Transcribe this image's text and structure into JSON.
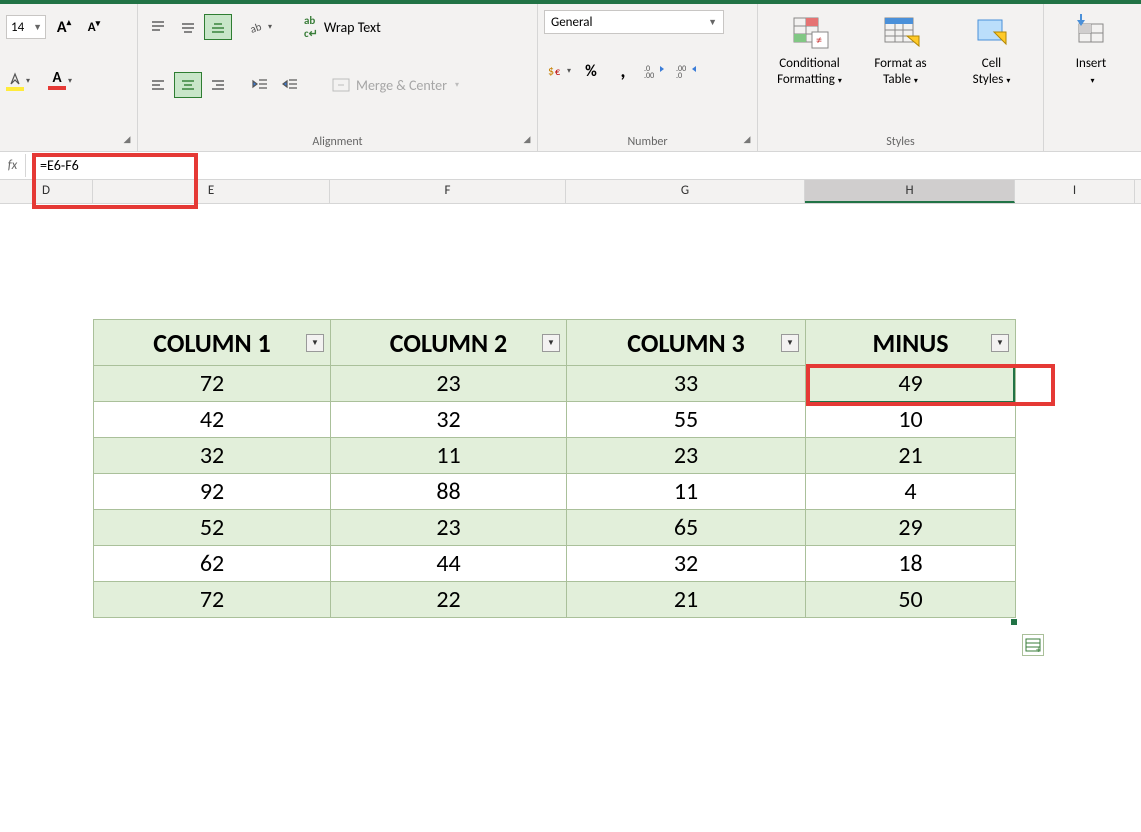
{
  "ribbon": {
    "font": {
      "size": "14",
      "increase_tip": "A",
      "decrease_tip": "A"
    },
    "alignment": {
      "label": "Alignment",
      "wrap": "Wrap Text",
      "merge": "Merge & Center"
    },
    "number": {
      "label": "Number",
      "format": "General"
    },
    "styles": {
      "label": "Styles",
      "conditional_line1": "Conditional",
      "conditional_line2": "Formatting",
      "formatas_line1": "Format as",
      "formatas_line2": "Table",
      "cellstyles_line1": "Cell",
      "cellstyles_line2": "Styles"
    },
    "cells": {
      "insert": "Insert"
    }
  },
  "formula": "=E6-F6",
  "columns": {
    "d": "D",
    "e": "E",
    "f": "F",
    "g": "G",
    "h": "H",
    "i": "I"
  },
  "table": {
    "headers": [
      "COLUMN 1",
      "COLUMN 2",
      "COLUMN 3",
      "MINUS"
    ],
    "rows": [
      [
        "72",
        "23",
        "33",
        "49"
      ],
      [
        "42",
        "32",
        "55",
        "10"
      ],
      [
        "32",
        "11",
        "23",
        "21"
      ],
      [
        "92",
        "88",
        "11",
        "4"
      ],
      [
        "52",
        "23",
        "65",
        "29"
      ],
      [
        "62",
        "44",
        "32",
        "18"
      ],
      [
        "72",
        "22",
        "21",
        "50"
      ]
    ]
  }
}
